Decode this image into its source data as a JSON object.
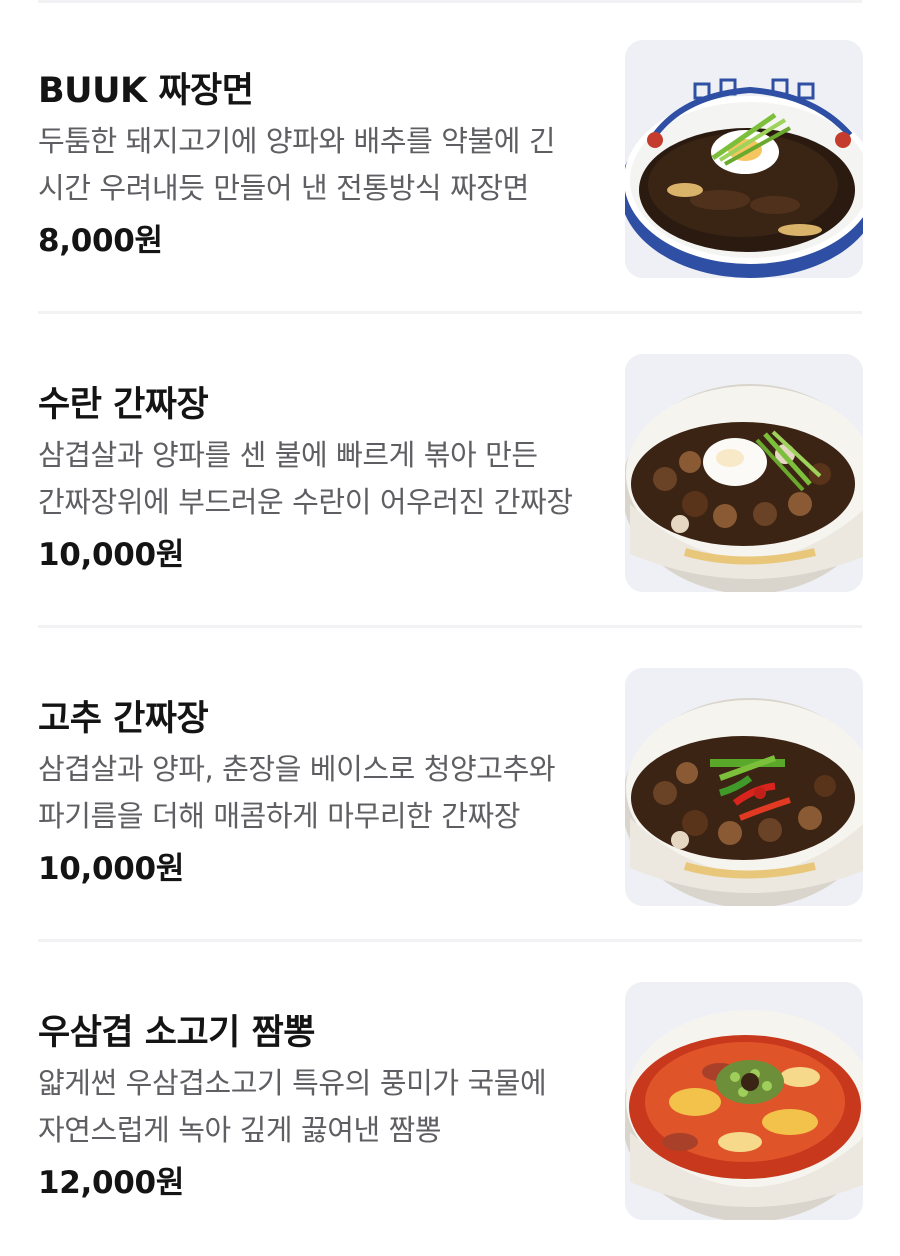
{
  "menu": {
    "items": [
      {
        "name": "BUUK 짜장면",
        "description": "두툼한 돼지고기에 양파와 배추를 약불에 긴 시간 우려내듯 만들어 낸 전통방식 짜장면",
        "price": "8,000원",
        "image_icon": "jjajangmyeon-bowl-image"
      },
      {
        "name": "수란 간짜장",
        "description": "삼겹살과 양파를 센 불에 빠르게 볶아 만든 간짜장위에 부드러운 수란이 어우러진 간짜장",
        "price": "10,000원",
        "image_icon": "poached-egg-ganjjajang-image"
      },
      {
        "name": "고추 간짜장",
        "description": "삼겹살과 양파, 춘장을 베이스로 청양고추와 파기름을 더해 매콤하게 마무리한 간짜장",
        "price": "10,000원",
        "image_icon": "pepper-ganjjajang-image"
      },
      {
        "name": "우삼겹 소고기 짬뽕",
        "description": "얇게썬 우삼겹소고기 특유의 풍미가 국물에 자연스럽게 녹아 깊게 끓여낸 짬뽕",
        "price": "12,000원",
        "image_icon": "beef-jjamppong-image"
      }
    ]
  },
  "colors": {
    "name_text": "#141414",
    "description_text": "#5f5f63",
    "divider": "#f2f2f4",
    "thumb_background": "#eef0f5"
  }
}
